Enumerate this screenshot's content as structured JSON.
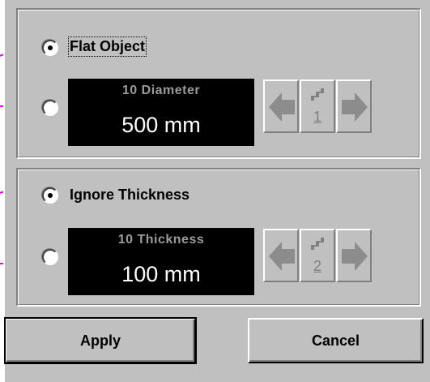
{
  "group_object": {
    "option_flat": "Flat Object",
    "diameter": {
      "caption": "10  Diameter",
      "value": "500 mm",
      "step": "1"
    }
  },
  "group_thickness": {
    "option_ignore": "Ignore Thickness",
    "thickness": {
      "caption": "10  Thickness",
      "value": "100 mm",
      "step": "2"
    }
  },
  "buttons": {
    "apply": "Apply",
    "cancel": "Cancel"
  },
  "colors": {
    "pointer": "#e800e8",
    "dialog_bg": "#c0c0c0",
    "display_bg": "#000000",
    "arrow_disabled": "#8c8c8c"
  },
  "icons": [
    "left-arrow-icon",
    "right-arrow-icon",
    "step-icon",
    "callout-pointer-icon"
  ]
}
